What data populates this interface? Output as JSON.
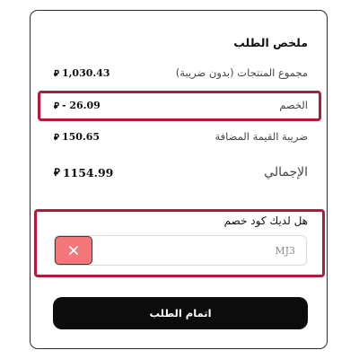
{
  "summary": {
    "title": "ملخص الطلب",
    "rows": {
      "subtotal": {
        "label": "مجموع المنتجات (بدون ضريبة)",
        "value": "1,030.43"
      },
      "discount": {
        "label": "الخصم",
        "value": "- 26.09"
      },
      "vat": {
        "label": "ضريبة القيمة المضافة",
        "value": "150.65"
      },
      "total": {
        "label": "الإجمالي",
        "value": "1154.99"
      }
    },
    "currency_symbol": "⃁"
  },
  "coupon": {
    "label": "هل لديك كود خصم",
    "value": "MJ3",
    "clear_icon": "close-icon"
  },
  "checkout": {
    "label": "اتمام الطلب"
  },
  "colors": {
    "highlight": "#b11a3b",
    "clear_button": "#f47678",
    "checkout_button": "#0c0c0c"
  }
}
